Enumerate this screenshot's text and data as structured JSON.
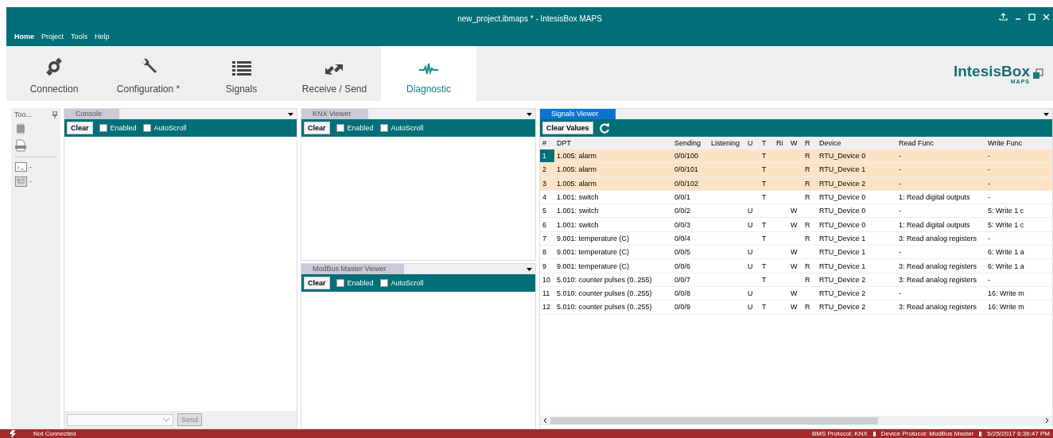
{
  "window": {
    "title": "new_project.ibmaps * - IntesisBox MAPS"
  },
  "menu": [
    {
      "label": "Home",
      "selected": true
    },
    {
      "label": "Project",
      "selected": false
    },
    {
      "label": "Tools",
      "selected": false
    },
    {
      "label": "Help",
      "selected": false
    }
  ],
  "ribbon_tabs": [
    {
      "label": "Connection",
      "kind": "connection",
      "selected": false
    },
    {
      "label": "Configuration *",
      "kind": "configuration",
      "selected": false
    },
    {
      "label": "Signals",
      "kind": "signals",
      "selected": false
    },
    {
      "label": "Receive / Send",
      "kind": "receive",
      "selected": false
    },
    {
      "label": "Diagnostic",
      "kind": "diagnostic",
      "selected": true
    }
  ],
  "logo": {
    "name": "IntesisBox",
    "sub": "MAPS"
  },
  "toolbox": {
    "title": "Too..."
  },
  "console": {
    "tab": {
      "label": "Console",
      "active": false
    },
    "clear": "Clear",
    "checkboxes": [
      {
        "label": "Enabled",
        "checked": false
      },
      {
        "label": "AutoScroll",
        "checked": false
      }
    ],
    "send": {
      "label": "Send",
      "disabled": true
    }
  },
  "knx_viewer": {
    "tab": {
      "label": "KNX Viewer",
      "active": false
    },
    "clear": "Clear",
    "checkboxes": [
      {
        "label": "Enabled",
        "checked": false
      },
      {
        "label": "AutoScroll",
        "checked": false
      }
    ]
  },
  "modbus_viewer": {
    "tab": {
      "label": "ModBus Master Viewer",
      "active": false
    },
    "clear": "Clear",
    "checkboxes": [
      {
        "label": "Enabled",
        "checked": false
      },
      {
        "label": "AutoScroll",
        "checked": false
      }
    ]
  },
  "signals_viewer": {
    "tab": {
      "label": "Signals Viewer",
      "active": true
    },
    "clear_values": "Clear Values",
    "table": {
      "columns": [
        "#",
        "DPT",
        "Sending",
        "Listening",
        "U",
        "T",
        "Ri",
        "W",
        "R",
        "Device",
        "Read Func",
        "Write Func"
      ],
      "rows": [
        {
          "cells": [
            "1",
            "1.005: alarm",
            "0/0/100",
            "",
            "",
            "T",
            "",
            "",
            "R",
            "RTU_Device 0",
            "-",
            "-"
          ],
          "highlighted": true,
          "selected": true
        },
        {
          "cells": [
            "2",
            "1.005: alarm",
            "0/0/101",
            "",
            "",
            "T",
            "",
            "",
            "R",
            "RTU_Device 1",
            "-",
            "-"
          ],
          "highlighted": true,
          "selected": false
        },
        {
          "cells": [
            "3",
            "1.005: alarm",
            "0/0/102",
            "",
            "",
            "T",
            "",
            "",
            "R",
            "RTU_Device 2",
            "-",
            "-"
          ],
          "highlighted": true,
          "selected": false
        },
        {
          "cells": [
            "4",
            "1.001: switch",
            "0/0/1",
            "",
            "",
            "T",
            "",
            "",
            "R",
            "RTU_Device 0",
            "1: Read digital outputs",
            "-"
          ],
          "highlighted": false,
          "selected": false
        },
        {
          "cells": [
            "5",
            "1.001: switch",
            "0/0/2",
            "",
            "U",
            "",
            "",
            "W",
            "",
            "RTU_Device 0",
            "-",
            "5: Write 1 c"
          ],
          "highlighted": false,
          "selected": false
        },
        {
          "cells": [
            "6",
            "1.001: switch",
            "0/0/3",
            "",
            "U",
            "T",
            "",
            "W",
            "R",
            "RTU_Device 0",
            "1: Read digital outputs",
            "5: Write 1 c"
          ],
          "highlighted": false,
          "selected": false
        },
        {
          "cells": [
            "7",
            "9.001: temperature (C)",
            "0/0/4",
            "",
            "",
            "T",
            "",
            "",
            "R",
            "RTU_Device 1",
            "3: Read analog registers",
            "-"
          ],
          "highlighted": false,
          "selected": false
        },
        {
          "cells": [
            "8",
            "9.001: temperature (C)",
            "0/0/5",
            "",
            "U",
            "",
            "",
            "W",
            "",
            "RTU_Device 1",
            "-",
            "6: Write 1 a"
          ],
          "highlighted": false,
          "selected": false
        },
        {
          "cells": [
            "9",
            "9.001: temperature (C)",
            "0/0/6",
            "",
            "U",
            "T",
            "",
            "W",
            "R",
            "RTU_Device 1",
            "3: Read analog registers",
            "6: Write 1 a"
          ],
          "highlighted": false,
          "selected": false
        },
        {
          "cells": [
            "10",
            "5.010: counter pulses (0..255)",
            "0/0/7",
            "",
            "",
            "T",
            "",
            "",
            "R",
            "RTU_Device 2",
            "3: Read analog registers",
            "-"
          ],
          "highlighted": false,
          "selected": false
        },
        {
          "cells": [
            "11",
            "5.010: counter pulses (0..255)",
            "0/0/8",
            "",
            "U",
            "",
            "",
            "W",
            "",
            "RTU_Device 2",
            "-",
            "16: Write m"
          ],
          "highlighted": false,
          "selected": false
        },
        {
          "cells": [
            "12",
            "5.010: counter pulses (0..255)",
            "0/0/9",
            "",
            "U",
            "T",
            "",
            "W",
            "R",
            "RTU_Device 2",
            "3: Read analog registers",
            "16: Write m"
          ],
          "highlighted": false,
          "selected": false
        }
      ]
    }
  },
  "status_bar": {
    "connection": "Not Connected",
    "items": [
      "BMS Protocol: KNX",
      "Device Protocol: ModBus Master",
      "5/25/2017 6:36:47 PM"
    ]
  }
}
